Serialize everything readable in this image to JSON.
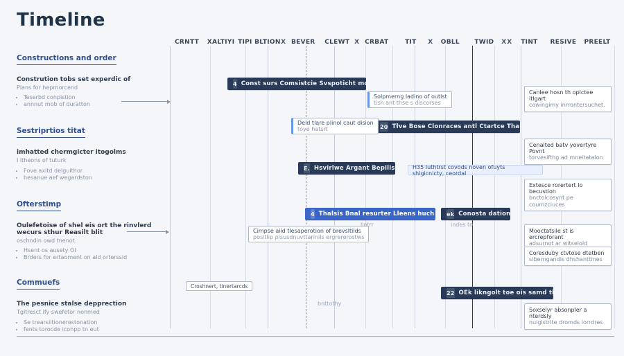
{
  "title": "Timeline",
  "columns": [
    "CRNTT",
    "XALTIYI",
    "TIPI BLTION",
    "X",
    "BEVER",
    "CLEWT",
    "X",
    "CRBAT",
    "TIT",
    "X",
    "OBLL",
    "TWID",
    "X",
    "X",
    "TINT",
    "RESIVE",
    "PREELT"
  ],
  "side": {
    "s1": {
      "heading": "Constructions and order",
      "sub": "Constrution tobs set experdic of",
      "note": "Plans for heprnorcend",
      "bullets": [
        "Teserbd conpistion",
        "annnut mob of duratton"
      ]
    },
    "s2": {
      "heading": "Sestriprtios titat",
      "sub": "imhatted chermgicter itogolms",
      "note": "I itheons of tuturk",
      "bullets": [
        "Fove axitd delguithor",
        "hesanue aef wegardston"
      ]
    },
    "s3": {
      "heading": "Ofterstimp",
      "sub": "Oulefetoise of shel eis ort the rinvlerd wecurs sthur Reasilt blit",
      "note": "oschndin owd tnenot.",
      "bullets": [
        "Hsent os ausety OI",
        "Brders for ertaoment on ald orterssid"
      ]
    },
    "s4": {
      "heading": "Commuefs",
      "sub": "The pesnice stalse depprection",
      "note": "Tgltresct ify swefetor nonmed",
      "bullets": [
        "Se trearsiltionerestonation",
        "fents torocde iconpp tn eut"
      ]
    }
  },
  "bars": {
    "b1": {
      "num": "4",
      "label": "Const surs Comsistcie Svspoticht moutiot"
    },
    "b2": {
      "num": "20",
      "label": "Tłve Bose Clonraces antl Ctartce Thaket"
    },
    "b3": {
      "num": "E.",
      "label": "Hsvirlwe Argant Bepilis"
    },
    "b4": {
      "num": "4",
      "label": "Thalsis Bnal resurter Lleens huch"
    },
    "b5": {
      "num": "ek",
      "label": "Conosta dation"
    },
    "b6": {
      "num": "22",
      "label": "OEk likngolt toe ois samd thck"
    }
  },
  "tags": {
    "t1": {
      "top": "Solpmerng ladino of outlst",
      "bot": "tish ant thse s discorses"
    },
    "t2": {
      "top": "Deld tlare plinol caut dision",
      "bot": "toye hatsrt"
    },
    "t3": "H35 Iuthtrst covods noven ofuyts shigicnicty, ceordal",
    "t4": {
      "top": "Cimpse aild tlesaperotion of brevsltilds",
      "bot": "positlip plsusdnuvttarinils ergrererostws"
    },
    "t5": "Croshnert, tinertarcds"
  },
  "chips": {
    "c1": {
      "a": "Canlee hosn th oplctee itlgart",
      "b": "cowingimy inrrontersuchet."
    },
    "c2": {
      "a": "Cenalted batv yovertyre Povnt",
      "b": "torvesifthg ad mneitatalon"
    },
    "c3": {
      "a": "Extesce rorertert lo becustion",
      "b": "bnctolcosynt pe coumzciuces"
    },
    "c4": {
      "a": "Mooctatsile st is ercrepforant",
      "b": "adsurnot ar witselold"
    },
    "c5": {
      "a": "Coresduby ctvtose dtetben",
      "b": "siberngandis dhshanttines"
    },
    "c6": {
      "a": "Soxselyr absonpler a nterdsly",
      "b": "nuiglstrite dromds lorrdres"
    }
  },
  "dim": {
    "d1": "llotrr",
    "d2": "indes to",
    "d3": "bnttothy"
  }
}
